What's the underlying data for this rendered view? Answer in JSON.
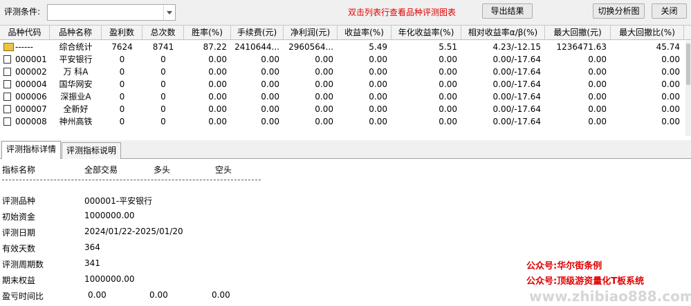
{
  "toolbar": {
    "condition_label": "评测条件:",
    "condition_value": "",
    "hint": "双击列表行查看品种评测图表",
    "export_label": "导出结果",
    "switch_label": "切换分析图",
    "close_label": "关闭"
  },
  "table": {
    "columns": [
      "品种代码",
      "品种名称",
      "盈利数",
      "总次数",
      "胜率(%)",
      "手续费(元)",
      "净利润(元)",
      "收益率(%)",
      "年化收益率(%)",
      "相对收益率α/β(%)",
      "最大回撤(元)",
      "最大回撤比(%)"
    ],
    "rows": [
      {
        "code": "------",
        "name": "综合统计",
        "wins": "7624",
        "total": "8741",
        "winrate": "87.22",
        "fee": "2410644...",
        "profit": "2960564...",
        "ret": "5.49",
        "annual": "5.51",
        "alpha": "4.23/-12.15",
        "dd": "1236471.63",
        "ddr": "45.74"
      },
      {
        "code": "000001",
        "name": "平安银行",
        "wins": "0",
        "total": "0",
        "winrate": "0.00",
        "fee": "0.00",
        "profit": "0.00",
        "ret": "0.00",
        "annual": "0.00",
        "alpha": "0.00/-17.64",
        "dd": "0.00",
        "ddr": "0.00"
      },
      {
        "code": "000002",
        "name": "万 科A",
        "wins": "0",
        "total": "0",
        "winrate": "0.00",
        "fee": "0.00",
        "profit": "0.00",
        "ret": "0.00",
        "annual": "0.00",
        "alpha": "0.00/-17.64",
        "dd": "0.00",
        "ddr": "0.00"
      },
      {
        "code": "000004",
        "name": "国华网安",
        "wins": "0",
        "total": "0",
        "winrate": "0.00",
        "fee": "0.00",
        "profit": "0.00",
        "ret": "0.00",
        "annual": "0.00",
        "alpha": "0.00/-17.64",
        "dd": "0.00",
        "ddr": "0.00"
      },
      {
        "code": "000006",
        "name": "深振业A",
        "wins": "0",
        "total": "0",
        "winrate": "0.00",
        "fee": "0.00",
        "profit": "0.00",
        "ret": "0.00",
        "annual": "0.00",
        "alpha": "0.00/-17.64",
        "dd": "0.00",
        "ddr": "0.00"
      },
      {
        "code": "000007",
        "name": "全新好",
        "wins": "0",
        "total": "0",
        "winrate": "0.00",
        "fee": "0.00",
        "profit": "0.00",
        "ret": "0.00",
        "annual": "0.00",
        "alpha": "0.00/-17.64",
        "dd": "0.00",
        "ddr": "0.00"
      },
      {
        "code": "000008",
        "name": "神州高铁",
        "wins": "0",
        "total": "0",
        "winrate": "0.00",
        "fee": "0.00",
        "profit": "0.00",
        "ret": "0.00",
        "annual": "0.00",
        "alpha": "0.00/-17.64",
        "dd": "0.00",
        "ddr": "0.00"
      }
    ]
  },
  "tabs": [
    "评测指标详情",
    "评测指标说明"
  ],
  "detail": {
    "headers": [
      "指标名称",
      "全部交易",
      "多头",
      "空头"
    ],
    "rows": [
      {
        "label": "评测品种",
        "all": "000001-平安银行",
        "long": "",
        "short": ""
      },
      {
        "label": "初始资金",
        "all": "1000000.00",
        "long": "",
        "short": ""
      },
      {
        "label": "评测日期",
        "all": "2024/01/22-2025/01/20",
        "long": "",
        "short": ""
      },
      {
        "label": "有效天数",
        "all": "364",
        "long": "",
        "short": ""
      },
      {
        "label": "评测周期数",
        "all": "341",
        "long": "",
        "short": ""
      },
      {
        "label": "期末权益",
        "all": "1000000.00",
        "long": "",
        "short": ""
      },
      {
        "label": "盈亏时间比",
        "all": "0.00",
        "long": "0.00",
        "short": "0.00"
      }
    ]
  },
  "watermarks": [
    "公众号:华尔街条例",
    "公众号:顶级游资量化T板系统",
    "www.zhibiao888.com"
  ],
  "colors": {
    "hint": "#e00000",
    "watermark": "#e00000"
  }
}
